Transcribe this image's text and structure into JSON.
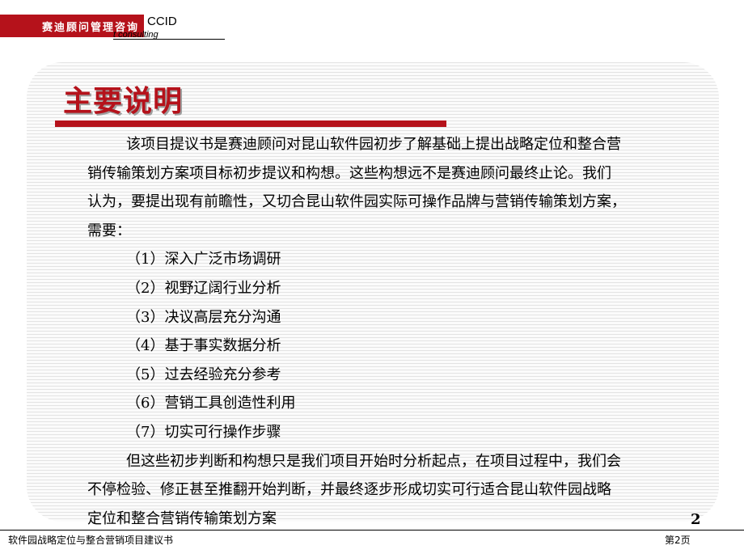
{
  "header": {
    "company_cn": "赛迪顾问管理咨询",
    "brand": "CCID",
    "brand_sub": "t consulting"
  },
  "slide": {
    "title": "主要说明",
    "intro_lines": [
      "该项目提议书是赛迪顾问对昆山软件园初步了解基础上提出战略定位和整合营",
      "销传输策划方案项目标初步提议和构想。这些构想远不是赛迪顾问最终止论。我们",
      "认为，要提出现有前瞻性，又切合昆山软件园实际可操作品牌与营销传输策划方案，",
      "需要："
    ],
    "list": [
      "（1）深入广泛市场调研",
      "（2）视野辽阔行业分析",
      "（3）决议高层充分沟通",
      "（4）基于事实数据分析",
      "（5）过去经验充分参考",
      "（6）营销工具创造性利用",
      "（7）切实可行操作步骤"
    ],
    "closing_lines": [
      "但这些初步判断和构想只是我们项目开始时分析起点，在项目过程中，我们会",
      "不停检验、修正甚至推翻开始判断，并最终逐步形成切实可行适合昆山软件园战略",
      "定位和整合营销传输策划方案"
    ],
    "page_number": "2"
  },
  "footer": {
    "doc_title": "软件园战略定位与整合营销项目建议书",
    "page_label": "第2页"
  },
  "colors": {
    "accent": "#b5121b"
  }
}
